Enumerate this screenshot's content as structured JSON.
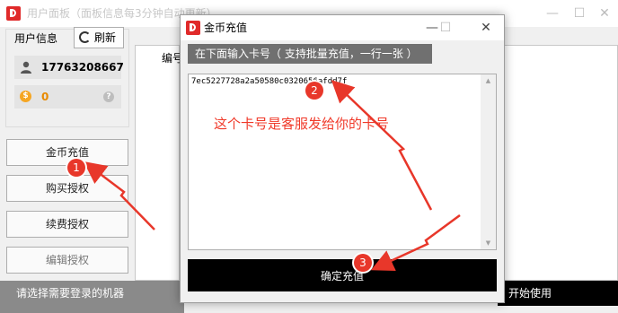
{
  "main_window": {
    "title": "用户面板（面板信息每3分钟自动更新）",
    "user_info": {
      "group_title": "用户信息",
      "refresh_label": "刷新",
      "phone": "17763208667",
      "balance": "0",
      "help_glyph": "?",
      "coin_glyph": "$"
    },
    "side_buttons": [
      {
        "label": "金币充值"
      },
      {
        "label": "购买授权"
      },
      {
        "label": "续费授权"
      },
      {
        "label": "编辑授权"
      }
    ],
    "list_header": "编号",
    "bottom_status": "请选择需要登录的机器",
    "start_label": "开始使用",
    "window_controls": {
      "minimize": "—",
      "maximize": "☐",
      "close": "✕"
    }
  },
  "dialog": {
    "title": "金币充值",
    "hint": "在下面输入卡号（ 支持批量充值，一行一张 ）",
    "card_input_value": "7ec5227728a2a50580c0320656afdd7f",
    "confirm_label": "确定充值",
    "window_controls": {
      "minimize": "—",
      "maximize": "☐",
      "close": "✕"
    },
    "scroll_up_glyph": "▲",
    "scroll_down_glyph": "▼"
  },
  "annotations": {
    "note": "这个卡号是客服发给你的卡号",
    "markers": [
      "1",
      "2",
      "3"
    ],
    "color": "#f03a2a"
  },
  "colors": {
    "logo_red": "#e02a2a",
    "coin_orange": "#f5a623",
    "bar_gray": "#8a8a8a",
    "hint_gray": "#707070"
  }
}
